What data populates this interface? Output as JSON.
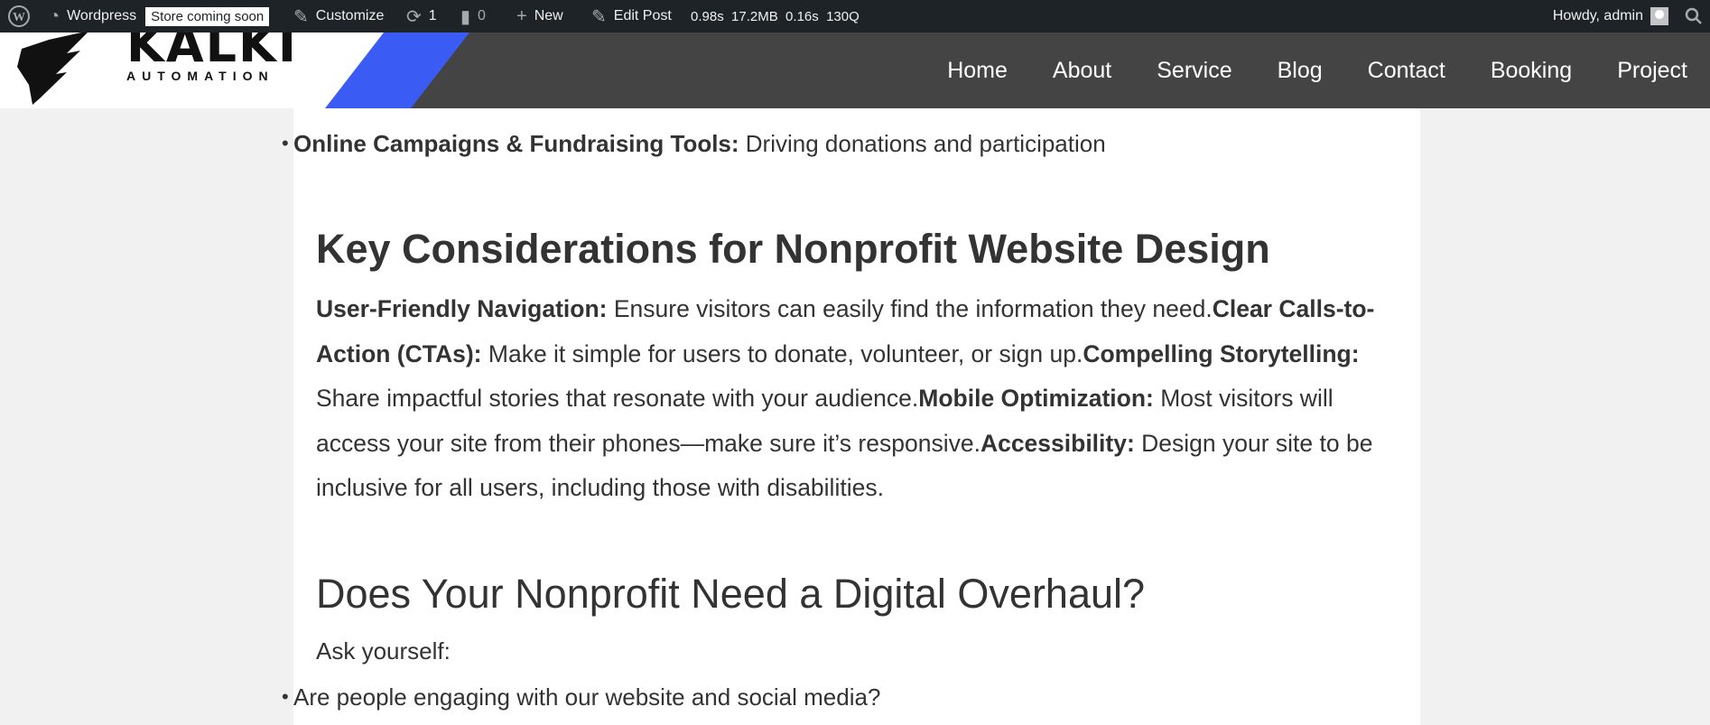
{
  "adminbar": {
    "site_name": "Wordpress",
    "store_badge": "Store coming soon",
    "customize": "Customize",
    "updates_count": "1",
    "comments_count": "0",
    "new_label": "New",
    "edit_post": "Edit Post",
    "perf": "0.98s  17.2MB  0.16s  130Q",
    "howdy": "Howdy, admin"
  },
  "header": {
    "logo_text": "KALKI",
    "logo_sub": "AUTOMATION",
    "nav": [
      "Home",
      "About",
      "Service",
      "Blog",
      "Contact",
      "Booking",
      "Project"
    ]
  },
  "article": {
    "bullet_top_bold": "Online Campaigns & Fundraising Tools:",
    "bullet_top_text": " Driving donations and participation",
    "heading1": "Key Considerations for Nonprofit Website Design",
    "p1_b1": "User-Friendly Navigation:",
    "p1_t1": " Ensure visitors can easily find the information they need.",
    "p1_b2": "Clear Calls-to-Action (CTAs):",
    "p1_t2": " Make it simple for users to donate, volunteer, or sign up.",
    "p1_b3": "Compelling Storytelling:",
    "p1_t3": " Share impactful stories that resonate with your audience.",
    "p1_b4": "Mobile Optimization:",
    "p1_t4": " Most visitors will access your site from their phones—make sure it’s responsive.",
    "p1_b5": "Accessibility:",
    "p1_t5": " Design your site to be inclusive for all users, including those with disabilities.",
    "heading2": "Does Your Nonprofit Need a Digital Overhaul?",
    "ask": "Ask yourself:",
    "bullet_bottom": "Are people engaging with our website and social media?"
  }
}
